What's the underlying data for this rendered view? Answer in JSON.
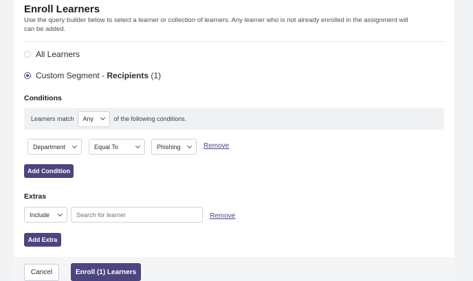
{
  "header": {
    "title": "Enroll Learners",
    "description": "Use the query builder below to select a learner or collection of learners. Any learner who is not already enrolled in the assignment will can be added."
  },
  "audience": {
    "all_label": "All Learners",
    "custom_label_prefix": "Custom Segment - ",
    "custom_label_bold": "Recipients",
    "custom_label_count": " (1)",
    "selected": "custom"
  },
  "conditions": {
    "label": "Conditions",
    "match_prefix": "Learners match",
    "match_value": "Any",
    "match_suffix": "of the following conditions.",
    "row": {
      "field": "Department",
      "operator": "Equal To",
      "value": "Phishing",
      "remove_label": "Remove"
    },
    "add_label": "Add Condition"
  },
  "extras": {
    "label": "Extras",
    "mode": "Include",
    "search_placeholder": "Search for learner",
    "remove_label": "Remove",
    "add_label": "Add Extra"
  },
  "footer": {
    "cancel_label": "Cancel",
    "enroll_label": "Enroll (1) Learners"
  },
  "colors": {
    "accent": "#4c4580"
  }
}
